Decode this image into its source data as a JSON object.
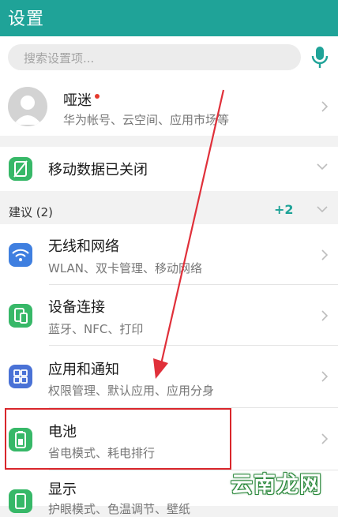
{
  "header": {
    "title": "设置"
  },
  "search": {
    "placeholder": "搜索设置项..."
  },
  "account": {
    "name": "哑迷",
    "subtitle": "华为帐号、云空间、应用市场等"
  },
  "mobile_data": {
    "label": "移动数据已关闭"
  },
  "suggestions": {
    "label": "建议 (2)",
    "count": "+2"
  },
  "items": [
    {
      "title": "无线和网络",
      "subtitle": "WLAN、双卡管理、移动网络",
      "icon": "wifi-icon",
      "color": "#3f7fe0"
    },
    {
      "title": "设备连接",
      "subtitle": "蓝牙、NFC、打印",
      "icon": "device-connect-icon",
      "color": "#37b868"
    },
    {
      "title": "应用和通知",
      "subtitle": "权限管理、默认应用、应用分身",
      "icon": "apps-icon",
      "color": "#4a72d6"
    },
    {
      "title": "电池",
      "subtitle": "省电模式、耗电排行",
      "icon": "battery-icon",
      "color": "#37b868"
    },
    {
      "title": "显示",
      "subtitle": "护眼模式、色温调节、壁纸",
      "icon": "display-icon",
      "color": "#37b868"
    }
  ],
  "watermark": {
    "text": "云南龙网"
  },
  "colors": {
    "accent": "#1fa398",
    "highlight": "#d9262b",
    "arrow": "#e0303a"
  }
}
